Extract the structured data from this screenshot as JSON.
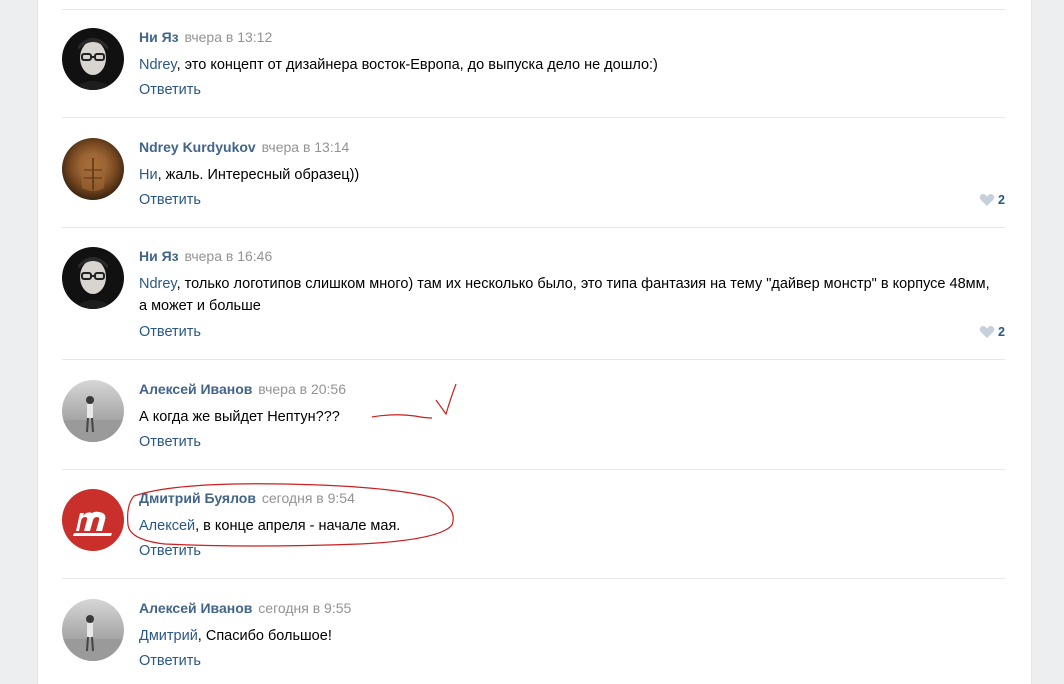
{
  "comments": [
    {
      "author": "Ни Яз",
      "time": "вчера в 13:12",
      "mention": "Ndrey",
      "text": ", это концепт от дизайнера восток-Европа, до выпуска дело не дошло:)",
      "reply": "Ответить",
      "likes": ""
    },
    {
      "author": "Ndrey Kurdyukov",
      "time": "вчера в 13:14",
      "mention": "Ни",
      "text": ", жаль. Интересный образец))",
      "reply": "Ответить",
      "likes": "2"
    },
    {
      "author": "Ни Яз",
      "time": "вчера в 16:46",
      "mention": "Ndrey",
      "text": ", только логотипов слишком много) там их несколько было, это типа фантазия на тему \"дайвер монстр\" в корпусе 48мм, а может и больше",
      "reply": "Ответить",
      "likes": "2"
    },
    {
      "author": "Алексей Иванов",
      "time": "вчера в 20:56",
      "mention": "",
      "text": "А когда же выйдет Нептун???",
      "reply": "Ответить",
      "likes": ""
    },
    {
      "author": "Дмитрий Буялов",
      "time": "сегодня в 9:54",
      "mention": "Алексей",
      "text": ", в конце апреля - начале мая.",
      "reply": "Ответить",
      "likes": ""
    },
    {
      "author": "Алексей Иванов",
      "time": "сегодня в 9:55",
      "mention": "Дмитрий",
      "text": ", Спасибо большое!",
      "reply": "Ответить",
      "likes": ""
    }
  ],
  "colors": {
    "author": "#42648b",
    "link": "#2a5885",
    "time": "#939393",
    "annotation": "#cc1f1f",
    "logo_bg": "#c9302c"
  },
  "icons": {
    "like": "heart-icon"
  }
}
